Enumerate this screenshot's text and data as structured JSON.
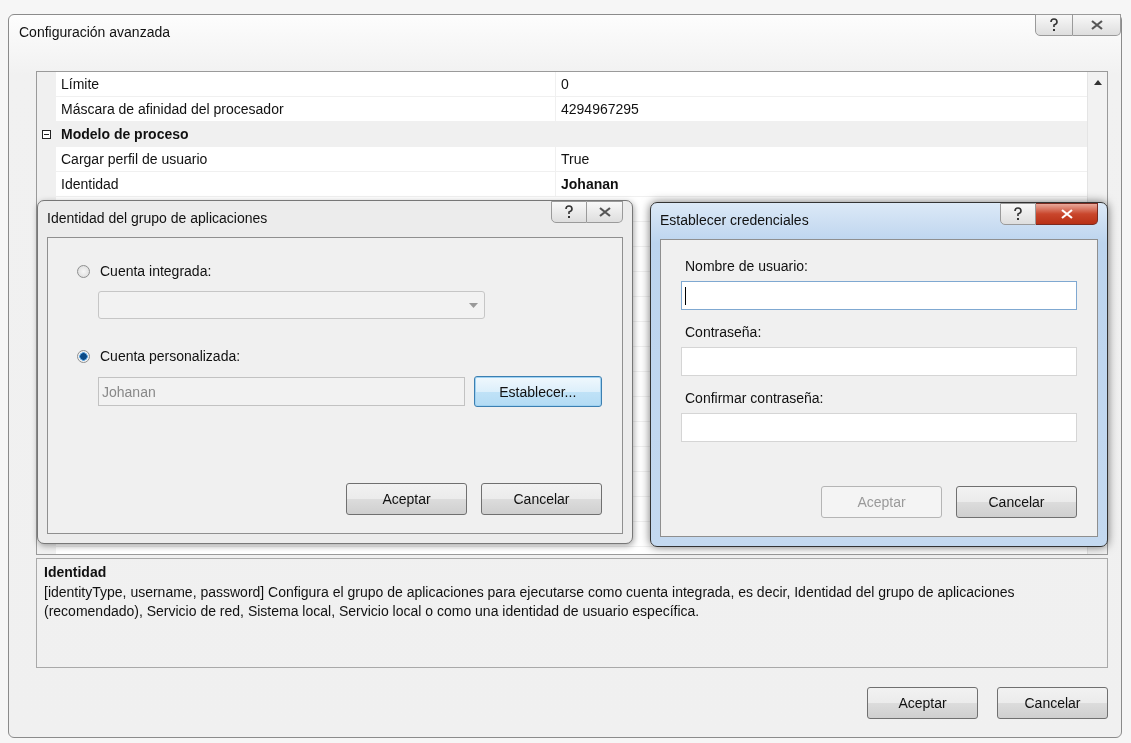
{
  "window": {
    "title": "Configuración avanzada"
  },
  "property_grid": {
    "rows": [
      {
        "kind": "property",
        "name": "Límite",
        "value": "0",
        "modified": false
      },
      {
        "kind": "property",
        "name": "Máscara de afinidad del procesador",
        "value": "4294967295",
        "modified": false
      },
      {
        "kind": "category",
        "name": "Modelo de proceso",
        "expanded": true
      },
      {
        "kind": "property",
        "name": "Cargar perfil de usuario",
        "value": "True",
        "modified": false
      },
      {
        "kind": "property",
        "name": "Identidad",
        "value": "Johanan",
        "modified": true
      }
    ]
  },
  "description": {
    "title": "Identidad",
    "text": "[identityType, username, password] Configura el grupo de aplicaciones para ejecutarse como cuenta integrada, es decir, Identidad del grupo de aplicaciones (recomendado), Servicio de red, Sistema local, Servicio local o como una identidad de usuario específica."
  },
  "buttons": [
    {
      "label": "Aceptar",
      "disabled": false
    },
    {
      "label": "Cancelar",
      "disabled": false
    }
  ],
  "identity_dialog": {
    "title": "Identidad del grupo de aplicaciones",
    "active": false,
    "options": [
      {
        "kind": "dropdown",
        "label": "Cuenta integrada:",
        "selected": false
      },
      {
        "kind": "account",
        "label": "Cuenta personalizada:",
        "selected": true,
        "value": "Johanan",
        "button": {
          "label": "Establecer...",
          "focused": true
        }
      }
    ],
    "buttons": [
      {
        "label": "Aceptar",
        "disabled": false
      },
      {
        "label": "Cancelar",
        "disabled": false
      }
    ]
  },
  "credentials_dialog": {
    "title": "Establecer credenciales",
    "active": true,
    "fields": [
      {
        "label": "Nombre de usuario:",
        "focused": true
      },
      {
        "label": "Contraseña:",
        "focused": false
      },
      {
        "label": "Confirmar contraseña:",
        "focused": false
      }
    ],
    "buttons": [
      {
        "label": "Aceptar",
        "disabled": true
      },
      {
        "label": "Cancelar",
        "disabled": false
      }
    ]
  }
}
